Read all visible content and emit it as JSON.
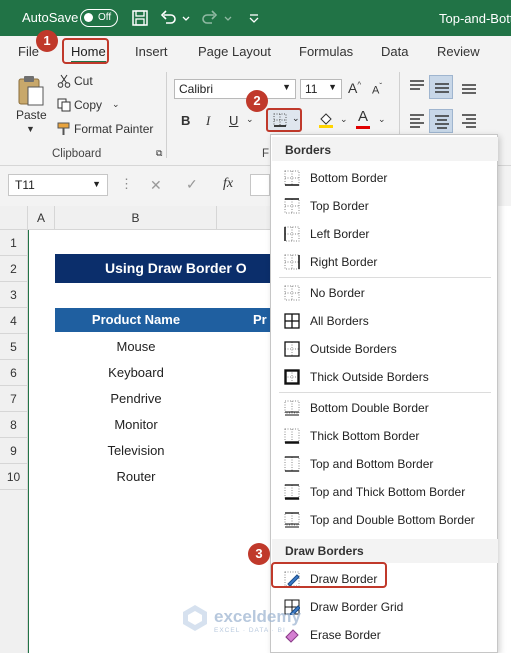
{
  "titlebar": {
    "autosave_label": "AutoSave",
    "toggle_state": "Off",
    "document_title": "Top-and-Bott"
  },
  "tabs": [
    "File",
    "Home",
    "Insert",
    "Page Layout",
    "Formulas",
    "Data",
    "Review"
  ],
  "ribbon": {
    "paste": "Paste",
    "cut": "Cut",
    "copy": "Copy",
    "format_painter": "Format Painter",
    "clipboard": "Clipboard",
    "font_name": "Calibri",
    "font_size": "11",
    "bold": "B",
    "italic": "I",
    "underline": "U",
    "font_color_letter": "A",
    "font_group_initial": "F"
  },
  "formula_bar": {
    "name_box": "T11",
    "fx": "fx"
  },
  "grid": {
    "columns": [
      "A",
      "B"
    ],
    "rows": [
      "1",
      "2",
      "3",
      "4",
      "5",
      "6",
      "7",
      "8",
      "9",
      "10"
    ],
    "banner": "Using Draw Border O",
    "header_product": "Product Name",
    "header_next": "Pr",
    "products": [
      "Mouse",
      "Keyboard",
      "Pendrive",
      "Monitor",
      "Television",
      "Router"
    ]
  },
  "menu": {
    "borders_header": "Borders",
    "draw_header": "Draw Borders",
    "group1": [
      "Bottom Border",
      "Top Border",
      "Left Border",
      "Right Border"
    ],
    "group2": [
      "No Border",
      "All Borders",
      "Outside Borders",
      "Thick Outside Borders"
    ],
    "group3": [
      "Bottom Double Border",
      "Thick Bottom Border",
      "Top and Bottom Border",
      "Top and Thick Bottom Border",
      "Top and Double Bottom Border"
    ],
    "group4": [
      "Draw Border",
      "Draw Border Grid",
      "Erase Border"
    ]
  },
  "steps": [
    "1",
    "2",
    "3"
  ],
  "watermark": {
    "name": "exceldemy",
    "tagline": "EXCEL · DATA · BI"
  },
  "colors": {
    "excel_green": "#217346",
    "annotation_red": "#c0392b",
    "banner_navy": "#0b2e6b",
    "table_header_blue": "#1f5fa0"
  }
}
